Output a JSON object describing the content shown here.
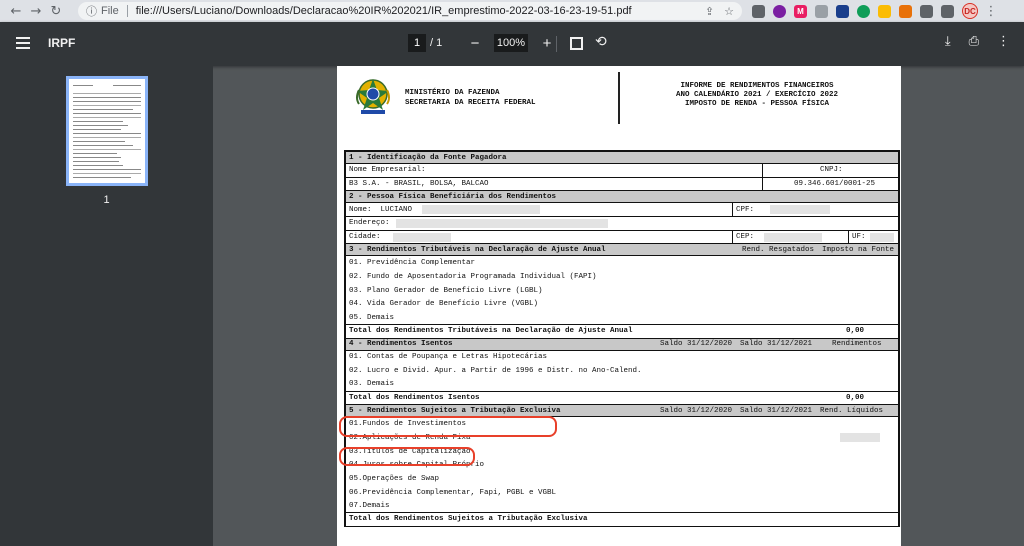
{
  "browser": {
    "scheme": "File",
    "url": "file:///Users/Luciano/Downloads/Declaracao%20IR%202021/IR_emprestimo-2022-03-16-23-19-51.pdf",
    "profile_initials": "DC"
  },
  "toolbar": {
    "title": "IRPF",
    "page_current": "1",
    "page_total": "/ 1",
    "zoom": "100%",
    "zoom_out": "−",
    "zoom_in": "+"
  },
  "sidebar": {
    "thumb_label": "1"
  },
  "header": {
    "ministry_line1": "MINISTÉRIO DA FAZENDA",
    "ministry_line2": "SECRETARIA DA RECEITA FEDERAL",
    "title_line1": "INFORME DE RENDIMENTOS FINANCEIROS",
    "title_line2": "ANO CALENDÁRIO 2021 / EXERCÍCIO 2022",
    "title_line3": "IMPOSTO DE RENDA - PESSOA FÍSICA"
  },
  "section1": {
    "title": "1 - Identificação da Fonte Pagadora",
    "name_label": "Nome Empresarial:",
    "cnpj_label": "CNPJ:",
    "name_value": "B3 S.A. - BRASIL, BOLSA, BALCAO",
    "cnpj_value": "09.346.601/0001-25"
  },
  "section2": {
    "title": "2 - Pessoa Física Beneficiária dos Rendimentos",
    "name_label": "Nome:",
    "name_value": "LUCIANO",
    "cpf_label": "CPF:",
    "address_label": "Endereço:",
    "city_label": "Cidade:",
    "cep_label": "CEP:",
    "uf_label": "UF:"
  },
  "section3": {
    "title": "3 - Rendimentos Tributáveis na Declaração de Ajuste Anual",
    "col1": "Rend. Resgatados",
    "col2": "Imposto na Fonte",
    "items": [
      "01. Previdência Complementar",
      "02. Fundo de Aposentadoria Programada Individual (FAPI)",
      "03. Plano Gerador de Benefício Livre (LGBL)",
      "04. Vida Gerador de Benefício Livre (VGBL)",
      "05. Demais"
    ],
    "total_label": "Total dos Rendimentos Tributáveis na Declaração de Ajuste Anual",
    "total_value": "0,00"
  },
  "section4": {
    "title": "4 - Rendimentos Isentos",
    "col1": "Saldo 31/12/2020",
    "col2": "Saldo 31/12/2021",
    "col3": "Rendimentos",
    "items": [
      "01. Contas de Poupança e Letras Hipotecárias",
      "02. Lucro e Divid. Apur. a Partir de 1996 e Distr. no Ano-Calend.",
      "03. Demais"
    ],
    "total_label": "Total dos Rendimentos Isentos",
    "total_value": "0,00"
  },
  "section5": {
    "title": "5 - Rendimentos Sujeitos a Tributação Exclusiva",
    "col1": "Saldo 31/12/2020",
    "col2": "Saldo 31/12/2021",
    "col3": "Rend. Líquidos",
    "items": [
      "01.Fundos de Investimentos",
      "02.Aplicações de Renda Fixa",
      "03.Títulos de Capitalização",
      "04.Juros sobre Capital Próprio",
      "05.Operações de Swap",
      "06.Previdência Complementar, Fapi, PGBL e VGBL",
      "07.Demais"
    ],
    "total_label": "Total dos Rendimentos Sujeitos a Tributação Exclusiva"
  },
  "colors": {
    "highlight": "#e8402a",
    "toolbar": "#323639",
    "viewer_bg": "#525659",
    "section_bg": "#c8c8c8"
  }
}
